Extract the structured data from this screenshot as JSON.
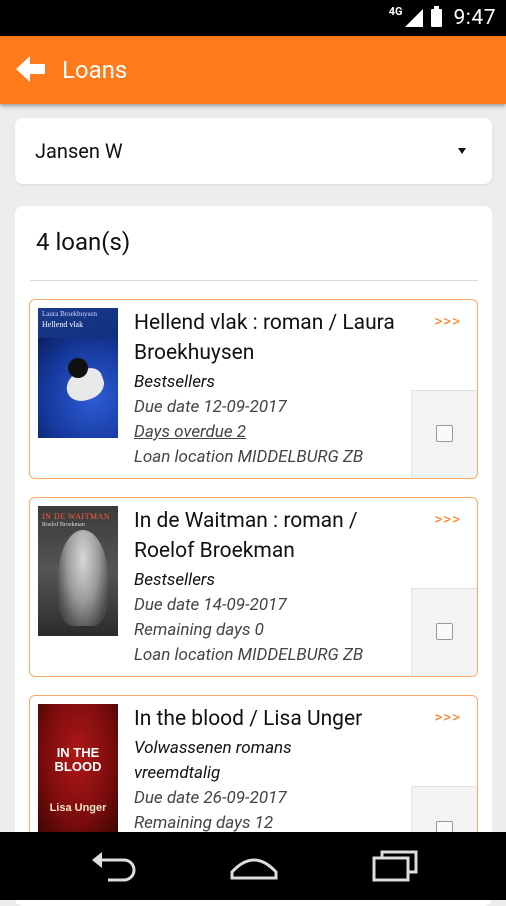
{
  "status_bar": {
    "network": "4G",
    "time": "9:47"
  },
  "action_bar": {
    "title": "Loans",
    "back_icon": "back-arrow-icon"
  },
  "user_select": {
    "value": "Jansen W"
  },
  "loans": {
    "count_label": "4 loan(s)",
    "more_label": ">>>",
    "items": [
      {
        "title": "Hellend vlak : roman / Laura Broekhuysen",
        "category": "Bestsellers",
        "due": "Due date 12-09-2017",
        "status": "Days overdue 2",
        "location": "Loan location MIDDELBURG ZB",
        "cover_author": "Laura Broekhuysen",
        "cover_title": "Hellend vlak"
      },
      {
        "title": "In de Waitman : roman / Roelof Broekman",
        "category": "Bestsellers",
        "due": "Due date 14-09-2017",
        "status": "Remaining days 0",
        "location": "Loan location MIDDELBURG ZB",
        "cover_title": "IN DE WAITMAN",
        "cover_author": "Roelof Broekman"
      },
      {
        "title": "In the blood / Lisa Unger",
        "category": "Volwassenen romans vreemdtalig",
        "due": "Due date 26-09-2017",
        "status": "Remaining days 12",
        "cover_title": "IN THE BLOOD",
        "cover_author": "Lisa Unger"
      }
    ]
  },
  "colors": {
    "accent": "#ff7a1a",
    "card_border": "#ffa868",
    "background": "#ececec"
  }
}
